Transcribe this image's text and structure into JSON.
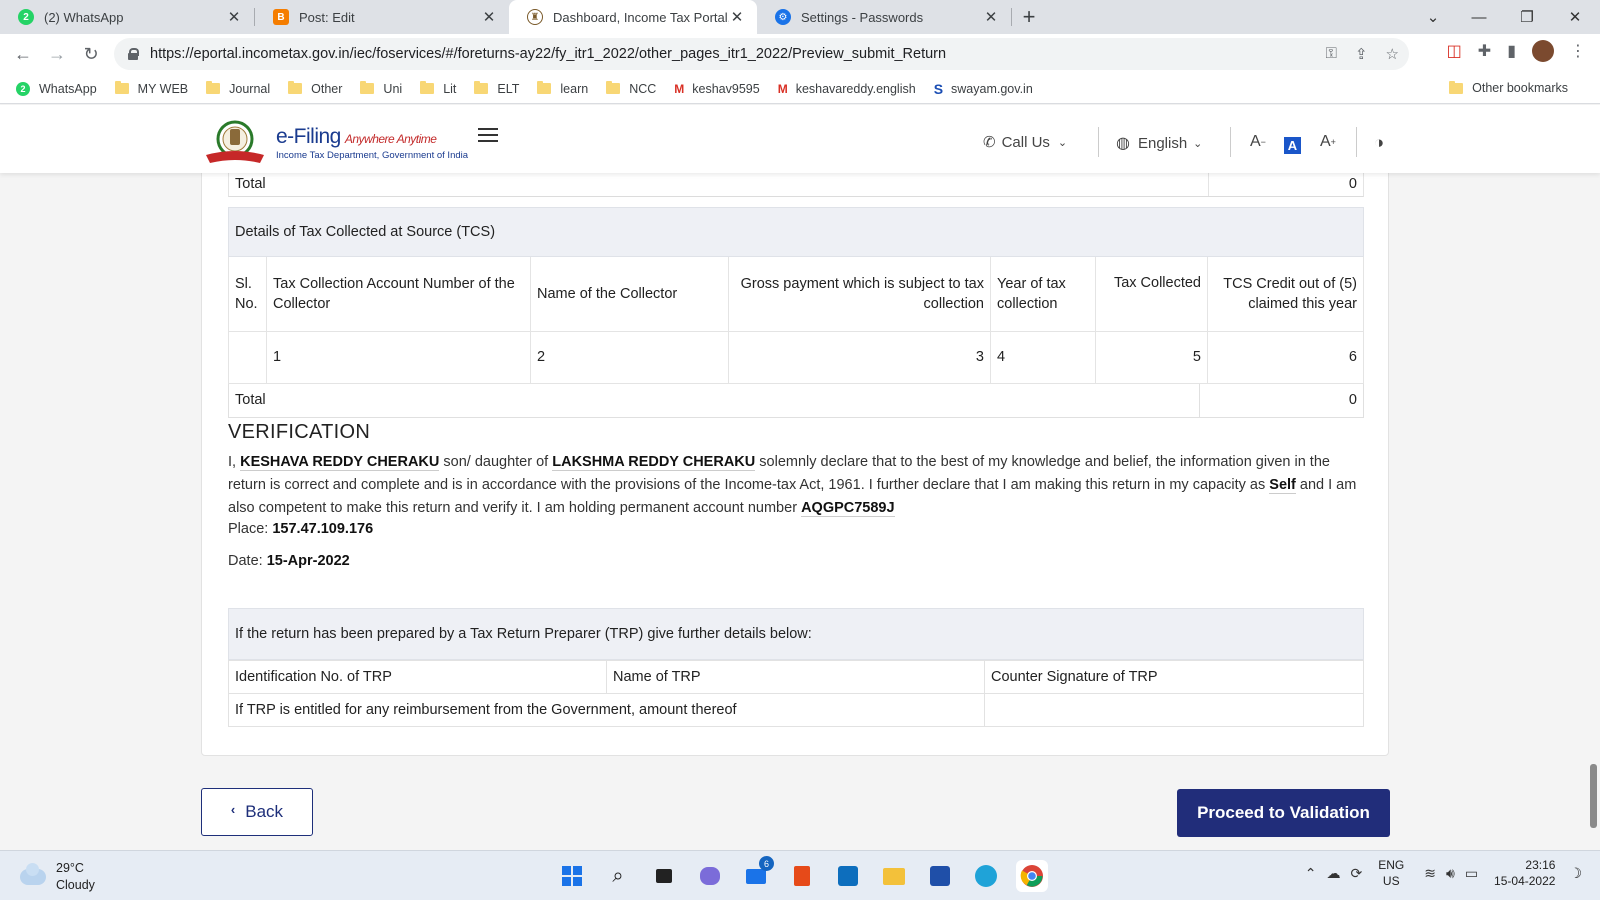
{
  "browser": {
    "tabs": [
      {
        "title": "(2) WhatsApp",
        "icon": "whatsapp-icon",
        "color": "#25d366",
        "badge": "2"
      },
      {
        "title": "Post: Edit",
        "icon": "blogger-icon",
        "color": "#f57d00",
        "badge": "B"
      },
      {
        "title": "Dashboard, Income Tax Portal, Go",
        "icon": "emblem-icon",
        "color": "#7a5a2a",
        "badge": ""
      },
      {
        "title": "Settings - Passwords",
        "icon": "gear-icon",
        "color": "#1a73e8",
        "badge": "⚙"
      }
    ],
    "url": "https://eportal.incometax.gov.in/iec/foservices/#/foreturns-ay22/fy_itr1_2022/other_pages_itr1_2022/Preview_submit_Return",
    "bookmarks": [
      {
        "label": "WhatsApp",
        "type": "circle",
        "color": "#25d366"
      },
      {
        "label": "MY WEB",
        "type": "folder"
      },
      {
        "label": "Journal",
        "type": "folder"
      },
      {
        "label": "Other",
        "type": "folder"
      },
      {
        "label": "Uni",
        "type": "folder"
      },
      {
        "label": "Lit",
        "type": "folder"
      },
      {
        "label": "ELT",
        "type": "folder"
      },
      {
        "label": "learn",
        "type": "folder"
      },
      {
        "label": "NCC",
        "type": "folder"
      },
      {
        "label": "keshav9595",
        "type": "gmail"
      },
      {
        "label": "keshavareddy.english",
        "type": "gmail"
      },
      {
        "label": "swayam.gov.in",
        "type": "swayam"
      }
    ],
    "other_bookmarks": "Other bookmarks"
  },
  "site": {
    "logo_title": "e-Filing",
    "logo_tagline": "Anywhere Anytime",
    "logo_sub": "Income Tax Department, Government of India",
    "call_us": "Call Us",
    "language": "English",
    "font_decrease": "A",
    "font_default": "A",
    "font_increase": "A"
  },
  "prev_total": {
    "label": "Total",
    "value": "0"
  },
  "tcs": {
    "heading": "Details of Tax Collected at Source (TCS)",
    "columns": [
      "Sl. No.",
      "Tax Collection Account Number of the Collector",
      "Name of the Collector",
      "Gross payment which is subject to tax collection",
      "Year of tax collection",
      "Tax Collected",
      "TCS Credit out of (5) claimed this year"
    ],
    "row": [
      "",
      "1",
      "2",
      "3",
      "4",
      "5",
      "6"
    ],
    "total_label": "Total",
    "total_value": "0"
  },
  "verification": {
    "title": "VERIFICATION",
    "t1": "I,",
    "name": "KESHAVA REDDY CHERAKU",
    "t2": "son/ daughter of",
    "father": "LAKSHMA REDDY CHERAKU",
    "t3": "solemnly declare that to the best of my knowledge and belief, the information given in the return is correct and complete and is in accordance with the provisions of the Income-tax Act, 1961. I further declare that I am making this return in my capacity as",
    "capacity": "Self",
    "t4": "and I am also competent to make this return and verify it. I am holding permanent account number",
    "pan": "AQGPC7589J",
    "place_label": "Place:",
    "place": "157.47.109.176",
    "date_label": "Date:",
    "date": "15-Apr-2022"
  },
  "trp": {
    "heading": "If the return has been prepared by a Tax Return Preparer (TRP) give further details below:",
    "col1": "Identification No. of TRP",
    "col2": "Name of TRP",
    "col3": "Counter Signature of TRP",
    "reimb": "If TRP is entitled for any reimbursement from the Government, amount thereof"
  },
  "actions": {
    "back": "Back",
    "proceed": "Proceed to Validation"
  },
  "taskbar": {
    "temp": "29°C",
    "weather": "Cloudy",
    "mail_badge": "6",
    "lang1": "ENG",
    "lang2": "US",
    "time": "23:16",
    "date": "15-04-2022"
  }
}
